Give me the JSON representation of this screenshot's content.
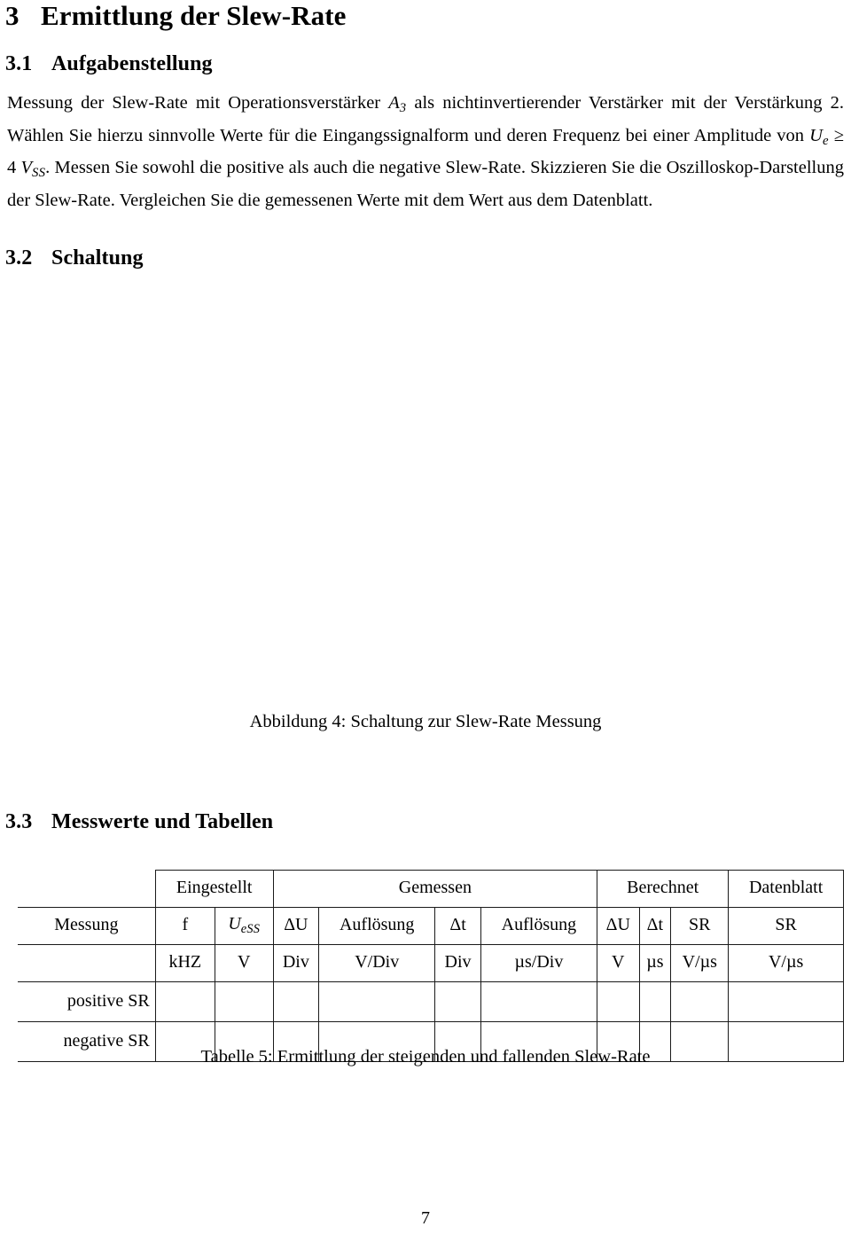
{
  "document": {
    "language": "de",
    "page_number": "7"
  },
  "sections": {
    "main": {
      "number": "3",
      "title": "Ermittlung der Slew-Rate"
    },
    "aufgabenstellung": {
      "number": "3.1",
      "title": "Aufgabenstellung"
    },
    "schaltung": {
      "number": "3.2",
      "title": "Schaltung"
    },
    "messwerte": {
      "number": "3.3",
      "title": "Messwerte und Tabellen"
    }
  },
  "paragraph": {
    "p1": "Messung der Slew-Rate mit Operationsverstärker ",
    "sym_a": "A",
    "sym_a_sub": "3",
    "p2": " als nichtinvertierender Verstärker mit der Verstärkung 2. Wählen Sie hierzu sinnvolle Werte für die Eingangssignalform und deren Frequenz bei einer Amplitude von ",
    "sym_u": "U",
    "sym_u_sub": "e",
    "ge": " ≥ 4 ",
    "sym_v": "V",
    "sym_v_sub": "SS",
    "p3": ". Messen Sie sowohl die positive als auch die negative Slew-Rate. Skizzieren Sie die Oszilloskop-Darstellung der Slew-Rate. Vergleichen Sie die gemessenen Werte mit dem Wert aus dem Datenblatt."
  },
  "figure": {
    "caption": "Abbildung 4: Schaltung zur Slew-Rate Messung",
    "content": ""
  },
  "table": {
    "caption": "Tabelle 5: Ermittlung der steigenden und fallenden Slew-Rate",
    "row_label_header": "Messung",
    "group_headers": [
      {
        "label": "Eingestellt",
        "span": 2
      },
      {
        "label": "Gemessen",
        "span": 4
      },
      {
        "label": "Berechnet",
        "span": 3
      },
      {
        "label": "Datenblatt",
        "span": 1
      }
    ],
    "quantity_headers": [
      {
        "symbol": "f",
        "sub": ""
      },
      {
        "symbol": "U",
        "sub": "eSS"
      },
      {
        "symbol": "ΔU",
        "sub": ""
      },
      {
        "symbol": "Auflösung",
        "sub": ""
      },
      {
        "symbol": "Δt",
        "sub": ""
      },
      {
        "symbol": "Auflösung",
        "sub": ""
      },
      {
        "symbol": "ΔU",
        "sub": ""
      },
      {
        "symbol": "Δt",
        "sub": ""
      },
      {
        "symbol": "SR",
        "sub": ""
      },
      {
        "symbol": "SR",
        "sub": ""
      }
    ],
    "unit_headers": [
      "kHZ",
      "V",
      "Div",
      "V/Div",
      "Div",
      "µs/Div",
      "V",
      "µs",
      "V/µs",
      "V/µs"
    ],
    "rows": [
      {
        "label": "positive SR",
        "cells": [
          "",
          "",
          "",
          "",
          "",
          "",
          "",
          "",
          "",
          ""
        ]
      },
      {
        "label": "negative SR",
        "cells": [
          "",
          "",
          "",
          "",
          "",
          "",
          "",
          "",
          "",
          ""
        ]
      }
    ]
  }
}
